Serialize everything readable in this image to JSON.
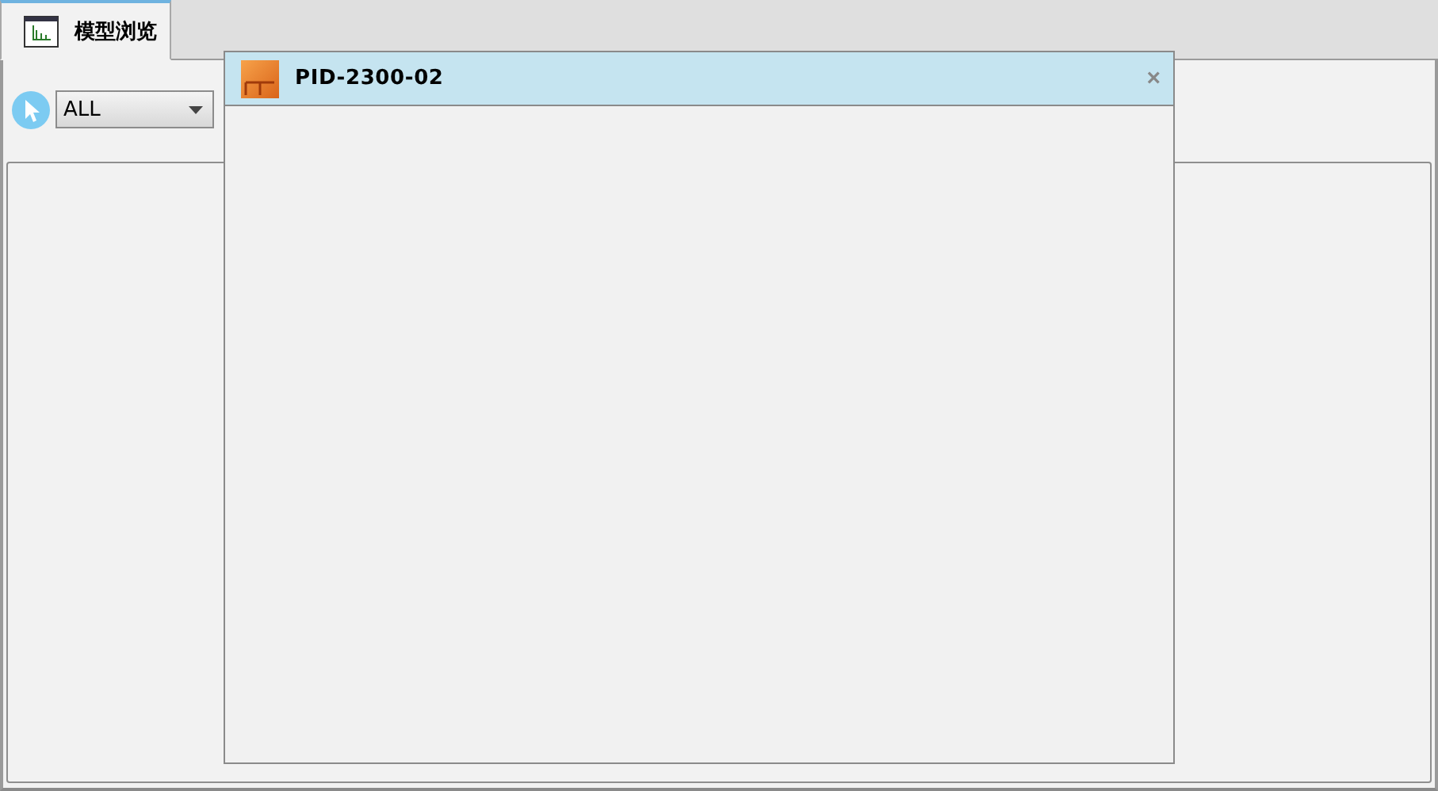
{
  "tabs": [
    {
      "label": "模型浏览",
      "selected": true
    }
  ],
  "toolbar": {
    "filter": {
      "value": "ALL"
    }
  },
  "dialog": {
    "title": "PID-2300-02",
    "close": "×"
  }
}
